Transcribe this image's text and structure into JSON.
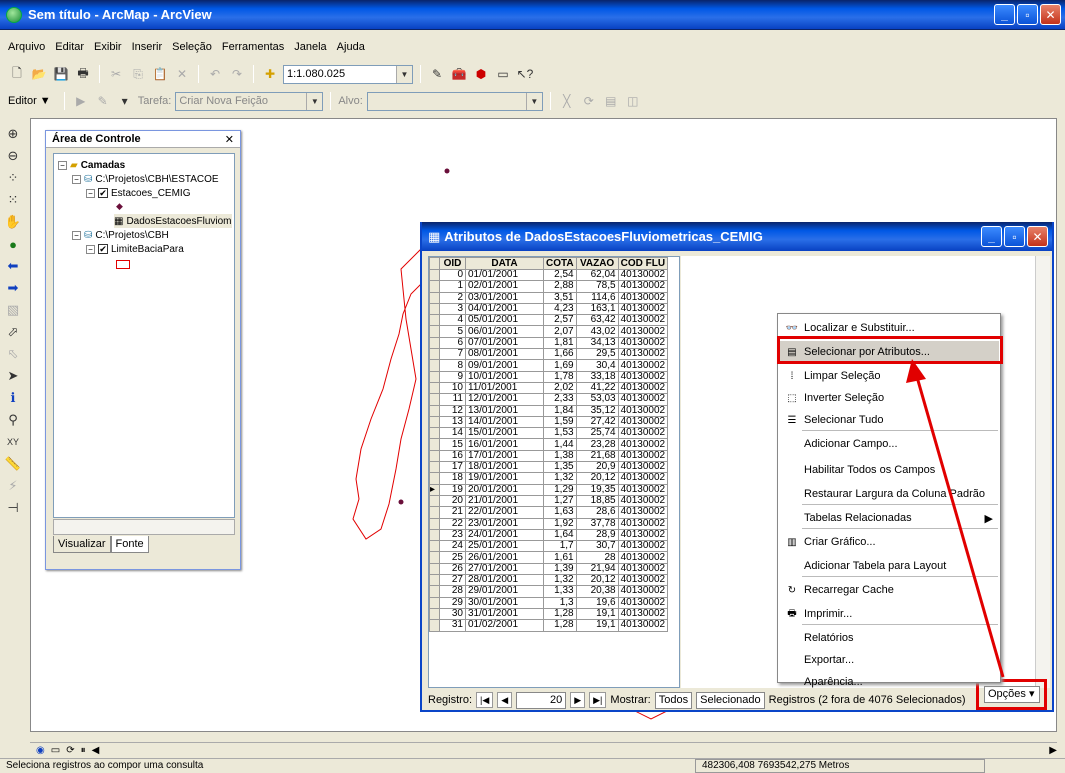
{
  "window": {
    "title": "Sem título - ArcMap - ArcView"
  },
  "menu": [
    "Arquivo",
    "Editar",
    "Exibir",
    "Inserir",
    "Seleção",
    "Ferramentas",
    "Janela",
    "Ajuda"
  ],
  "toolbar": {
    "scale": "1:1.080.025"
  },
  "editor": {
    "label": "Editor ▼",
    "tarefa_label": "Tarefa:",
    "tarefa_value": "Criar Nova Feição",
    "alvo_label": "Alvo:"
  },
  "toc": {
    "title": "Área de Controle",
    "layers_root": "Camadas",
    "path1": "C:\\Projetos\\CBH\\ESTACOE",
    "layer1": "Estacoes_CEMIG",
    "table1": "DadosEstacoesFluviom",
    "path2": "C:\\Projetos\\CBH",
    "layer2": "LimiteBaciaPara",
    "tab_visualizar": "Visualizar",
    "tab_fonte": "Fonte"
  },
  "attr_table": {
    "title": "Atributos de DadosEstacoesFluviometricas_CEMIG",
    "columns": [
      "OID",
      "DATA",
      "COTA",
      "VAZAO",
      "COD FLU"
    ],
    "rows": [
      [
        "0",
        "01/01/2001",
        "2,54",
        "62,04",
        "40130002"
      ],
      [
        "1",
        "02/01/2001",
        "2,88",
        "78,5",
        "40130002"
      ],
      [
        "2",
        "03/01/2001",
        "3,51",
        "114,6",
        "40130002"
      ],
      [
        "3",
        "04/01/2001",
        "4,23",
        "163,1",
        "40130002"
      ],
      [
        "4",
        "05/01/2001",
        "2,57",
        "63,42",
        "40130002"
      ],
      [
        "5",
        "06/01/2001",
        "2,07",
        "43,02",
        "40130002"
      ],
      [
        "6",
        "07/01/2001",
        "1,81",
        "34,13",
        "40130002"
      ],
      [
        "7",
        "08/01/2001",
        "1,66",
        "29,5",
        "40130002"
      ],
      [
        "8",
        "09/01/2001",
        "1,69",
        "30,4",
        "40130002"
      ],
      [
        "9",
        "10/01/2001",
        "1,78",
        "33,18",
        "40130002"
      ],
      [
        "10",
        "11/01/2001",
        "2,02",
        "41,22",
        "40130002"
      ],
      [
        "11",
        "12/01/2001",
        "2,33",
        "53,03",
        "40130002"
      ],
      [
        "12",
        "13/01/2001",
        "1,84",
        "35,12",
        "40130002"
      ],
      [
        "13",
        "14/01/2001",
        "1,59",
        "27,42",
        "40130002"
      ],
      [
        "14",
        "15/01/2001",
        "1,53",
        "25,74",
        "40130002"
      ],
      [
        "15",
        "16/01/2001",
        "1,44",
        "23,28",
        "40130002"
      ],
      [
        "16",
        "17/01/2001",
        "1,38",
        "21,68",
        "40130002"
      ],
      [
        "17",
        "18/01/2001",
        "1,35",
        "20,9",
        "40130002"
      ],
      [
        "18",
        "19/01/2001",
        "1,32",
        "20,12",
        "40130002"
      ],
      [
        "19",
        "20/01/2001",
        "1,29",
        "19,35",
        "40130002"
      ],
      [
        "20",
        "21/01/2001",
        "1,27",
        "18,85",
        "40130002"
      ],
      [
        "21",
        "22/01/2001",
        "1,63",
        "28,6",
        "40130002"
      ],
      [
        "22",
        "23/01/2001",
        "1,92",
        "37,78",
        "40130002"
      ],
      [
        "23",
        "24/01/2001",
        "1,64",
        "28,9",
        "40130002"
      ],
      [
        "24",
        "25/01/2001",
        "1,7",
        "30,7",
        "40130002"
      ],
      [
        "25",
        "26/01/2001",
        "1,61",
        "28",
        "40130002"
      ],
      [
        "26",
        "27/01/2001",
        "1,39",
        "21,94",
        "40130002"
      ],
      [
        "27",
        "28/01/2001",
        "1,32",
        "20,12",
        "40130002"
      ],
      [
        "28",
        "29/01/2001",
        "1,33",
        "20,38",
        "40130002"
      ],
      [
        "29",
        "30/01/2001",
        "1,3",
        "19,6",
        "40130002"
      ],
      [
        "30",
        "31/01/2001",
        "1,28",
        "19,1",
        "40130002"
      ],
      [
        "31",
        "01/02/2001",
        "1,28",
        "19,1",
        "40130002"
      ]
    ],
    "current_row_index": 19,
    "footer": {
      "registro_label": "Registro:",
      "registro_value": "20",
      "mostrar_label": "Mostrar:",
      "todos": "Todos",
      "selecionado": "Selecionado",
      "registros_info": "Registros (2 fora de  4076 Selecionados)",
      "opcoes": "Opções"
    }
  },
  "context_menu": {
    "items": [
      {
        "label": "Localizar e Substituir...",
        "icon": "binoculars-icon"
      },
      {
        "label": "Selecionar por Atributos...",
        "icon": "sql-icon"
      },
      {
        "label": "Limpar Seleção",
        "icon": "clear-selection-icon"
      },
      {
        "label": "Inverter Seleção",
        "icon": "invert-selection-icon"
      },
      {
        "label": "Selecionar Tudo",
        "icon": "select-all-icon"
      },
      {
        "label": "Adicionar Campo...",
        "icon": ""
      },
      {
        "label": "Habilitar Todos os Campos",
        "icon": ""
      },
      {
        "label": "Restaurar Largura da Coluna Padrão",
        "icon": ""
      },
      {
        "label": "Tabelas Relacionadas",
        "icon": ""
      },
      {
        "label": "Criar Gráfico...",
        "icon": "graph-icon"
      },
      {
        "label": "Adicionar Tabela para Layout",
        "icon": ""
      },
      {
        "label": "Recarregar Cache",
        "icon": "refresh-icon"
      },
      {
        "label": "Imprimir...",
        "icon": "printer-icon"
      },
      {
        "label": "Relatórios",
        "icon": ""
      },
      {
        "label": "Exportar...",
        "icon": ""
      },
      {
        "label": "Aparência...",
        "icon": ""
      }
    ]
  },
  "status": {
    "message": "Seleciona registros ao compor uma consulta",
    "coords": "482306,408 7693542,275 Metros"
  },
  "colors": {
    "highlight_red": "#e10000",
    "xp_blue": "#0058e6"
  }
}
